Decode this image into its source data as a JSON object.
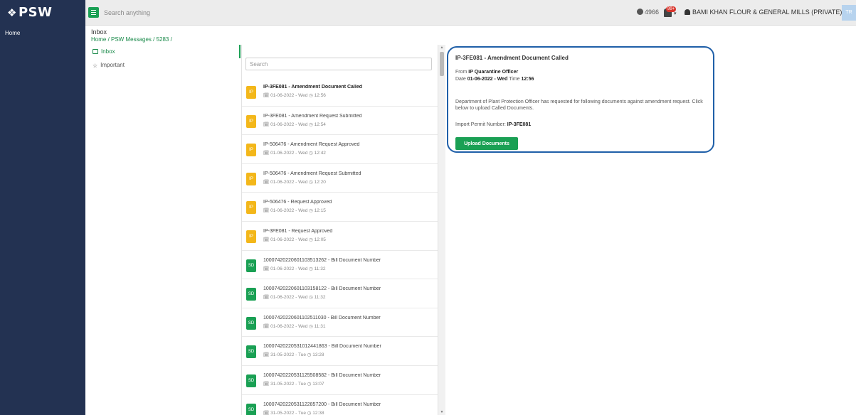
{
  "brand": {
    "logo_text": "PSW",
    "logo_symbol": "❖"
  },
  "topbar": {
    "search_placeholder": "Search anything",
    "counter": "4966",
    "notification_badge": "99+",
    "user_name": "BAMI KHAN FLOUR & GENERAL MILLS (PRIVATE)LIMITED",
    "avatar_initials": "TR"
  },
  "leftnav": {
    "home_label": "Home"
  },
  "page": {
    "title": "Inbox",
    "breadcrumb": "Home / PSW Messages / 5283 /"
  },
  "folders": [
    {
      "label": "Inbox",
      "icon": "inbox-icon",
      "active": true
    },
    {
      "label": "Important",
      "icon": "star-icon",
      "active": false
    }
  ],
  "message_list": {
    "search_placeholder": "Search",
    "messages": [
      {
        "type": "IP",
        "subject": "IP-3FE081 - Amendment Document Called",
        "date": "01-06-2022 - Wed",
        "time": "12:56",
        "unread": true
      },
      {
        "type": "IP",
        "subject": "IP-3FE081 - Amendment Request Submitted",
        "date": "01-06-2022 - Wed",
        "time": "12:54",
        "unread": false
      },
      {
        "type": "IP",
        "subject": "IP-506476 - Amendment Request Approved",
        "date": "01-06-2022 - Wed",
        "time": "12:42",
        "unread": false
      },
      {
        "type": "IP",
        "subject": "IP-506476 - Amendment Request Submitted",
        "date": "01-06-2022 - Wed",
        "time": "12:20",
        "unread": false
      },
      {
        "type": "IP",
        "subject": "IP-506476 - Request Approved",
        "date": "01-06-2022 - Wed",
        "time": "12:15",
        "unread": false
      },
      {
        "type": "IP",
        "subject": "IP-3FE081 - Request Approved",
        "date": "01-06-2022 - Wed",
        "time": "12:05",
        "unread": false
      },
      {
        "type": "SD",
        "subject": "1000742022060110351326​2 - Bill Document Number",
        "date": "01-06-2022 - Wed",
        "time": "11:32",
        "unread": false
      },
      {
        "type": "SD",
        "subject": "1000742022060110315812​2 - Bill Document Number",
        "date": "01-06-2022 - Wed",
        "time": "11:32",
        "unread": false
      },
      {
        "type": "SD",
        "subject": "1000742022060110251103​0 - Bill Document Number",
        "date": "01-06-2022 - Wed",
        "time": "11:31",
        "unread": false
      },
      {
        "type": "SD",
        "subject": "1000742022053101244186​3 - Bill Document Number",
        "date": "31-05-2022 - Tue",
        "time": "13:28",
        "unread": false
      },
      {
        "type": "SD",
        "subject": "1000742022053112550858​2 - Bill Document Number",
        "date": "31-05-2022 - Tue",
        "time": "13:07",
        "unread": false
      },
      {
        "type": "SD",
        "subject": "1000742022053112285720​0 - Bill Document Number",
        "date": "31-05-2022 - Tue",
        "time": "12:38",
        "unread": false
      }
    ]
  },
  "detail": {
    "subject": "IP-3FE081 - Amendment Document Called",
    "from_label": "From",
    "from_value": "IP Quarantine Officer",
    "date_label": "Date",
    "date_value": "01-06-2022 - Wed",
    "time_label": "Time",
    "time_value": "12:56",
    "body": "Department of Plant Protection Officer has requested for following documents against amendment request. Click below to upload Called Documents.",
    "permit_label": "Import Permit Number:",
    "permit_value": "IP-3FE081",
    "upload_button": "Upload Documents"
  },
  "colors": {
    "nav": "#233252",
    "accent_green": "#1aa054",
    "ip_badge": "#f3b71a",
    "highlight_border": "#1f5fa8"
  }
}
